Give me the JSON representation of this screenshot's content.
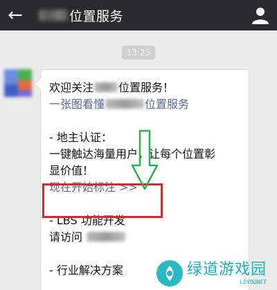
{
  "header": {
    "title": "位置服务",
    "back_icon": "←",
    "profile_icon": "person-icon"
  },
  "chat": {
    "timestamp": "13:25",
    "message": {
      "welcome_prefix": "欢迎关注",
      "welcome_suffix": "位置服务！",
      "link_intro_prefix": "一张图看懂",
      "link_intro_suffix": "位置服务",
      "landlord_heading": "- 地主认证：",
      "landlord_line1": "一键触达海量用户，让每个位置彰",
      "landlord_line2": "显价值！",
      "start_link": "现在开始标注 >>",
      "lbs_heading": "- LBS 功能开发",
      "visit_prefix": "请访问",
      "partial_line": "- 行业解决方案"
    }
  },
  "annotation": {
    "highlight_color": "#d9262c",
    "arrow_color": "#2fae4b"
  },
  "watermark": {
    "title": "绿道游戏园",
    "url": "LDYOUNET",
    "color": "#19b3c0"
  }
}
